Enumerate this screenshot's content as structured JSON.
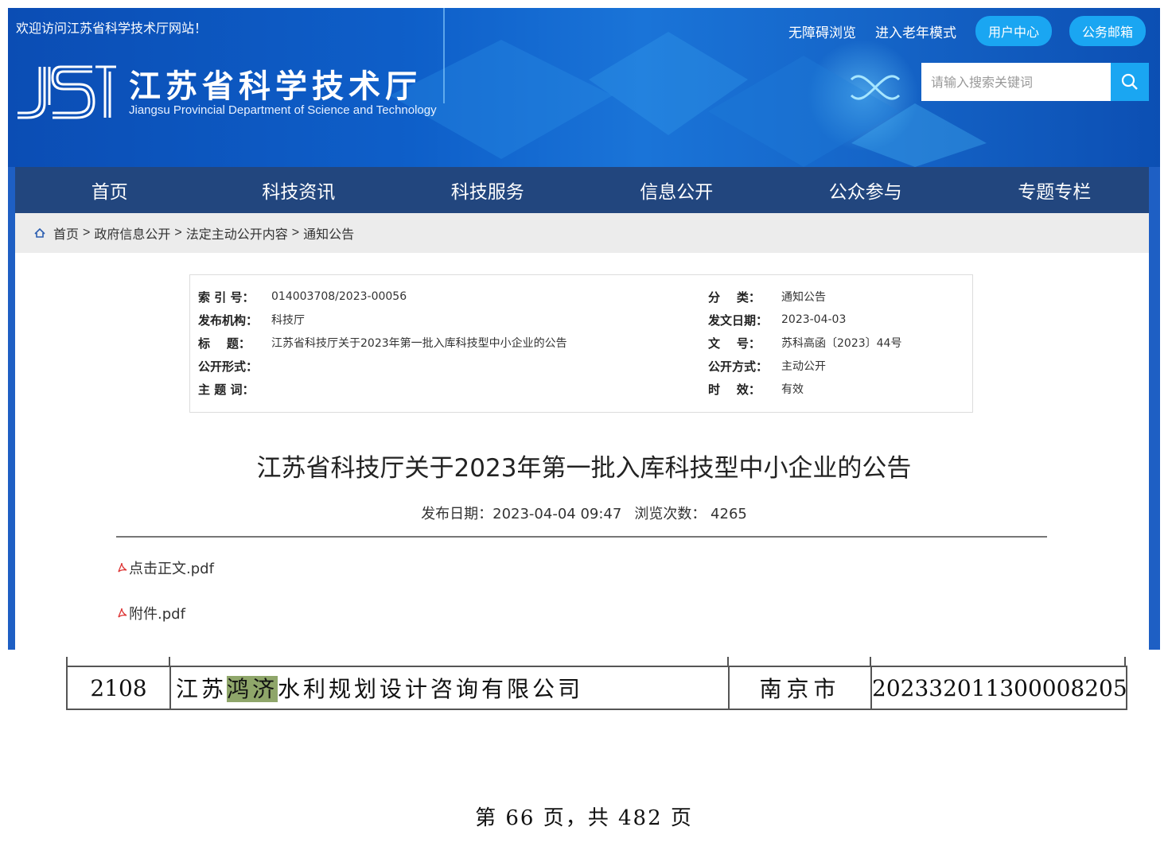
{
  "header": {
    "welcome": "欢迎访问江苏省科学技术厅网站！",
    "links": [
      "无障碍浏览",
      "进入老年模式"
    ],
    "buttons": [
      "用户中心",
      "公务邮箱"
    ],
    "site_name": "江苏省科学技术厅",
    "site_name_en": "Jiangsu Provincial Department of Science and Technology",
    "search_placeholder": "请输入搜索关键词"
  },
  "nav": [
    "首页",
    "科技资讯",
    "科技服务",
    "信息公开",
    "公众参与",
    "专题专栏"
  ],
  "breadcrumb": [
    "首页",
    "政府信息公开",
    "法定主动公开内容",
    "通知公告"
  ],
  "meta": {
    "left": [
      {
        "label": "索 引 号：",
        "value": "014003708/2023-00056"
      },
      {
        "label": "发布机构：",
        "value": "科技厅"
      },
      {
        "label": "标    题：",
        "value": "江苏省科技厅关于2023年第一批入库科技型中小企业的公告"
      },
      {
        "label": "公开形式：",
        "value": ""
      },
      {
        "label": "主 题 词：",
        "value": ""
      }
    ],
    "right": [
      {
        "label": "分    类：",
        "value": "通知公告"
      },
      {
        "label": "发文日期：",
        "value": "2023-04-03"
      },
      {
        "label": "文    号：",
        "value": "苏科高函〔2023〕44号"
      },
      {
        "label": "公开方式：",
        "value": "主动公开"
      },
      {
        "label": "时    效：",
        "value": "有效"
      }
    ]
  },
  "article": {
    "title": "江苏省科技厅关于2023年第一批入库科技型中小企业的公告",
    "publish": "发布日期：2023-04-04 09:47",
    "views": "浏览次数： 4265",
    "attachments": [
      "点击正文.pdf",
      "附件.pdf"
    ]
  },
  "pdf": {
    "row": {
      "no": "2108",
      "name_pre": "江苏",
      "name_highlight": "鸿济",
      "name_post": "水利规划设计咨询有限公司",
      "city": "南京市",
      "code": "202332011300008205"
    },
    "page_footer": "第 66 页，共 482 页"
  },
  "colors": {
    "nav": "#22467e",
    "accent": "#1aa6f2",
    "banner": "#0e5fc9",
    "highlight": "#8fa66a"
  }
}
